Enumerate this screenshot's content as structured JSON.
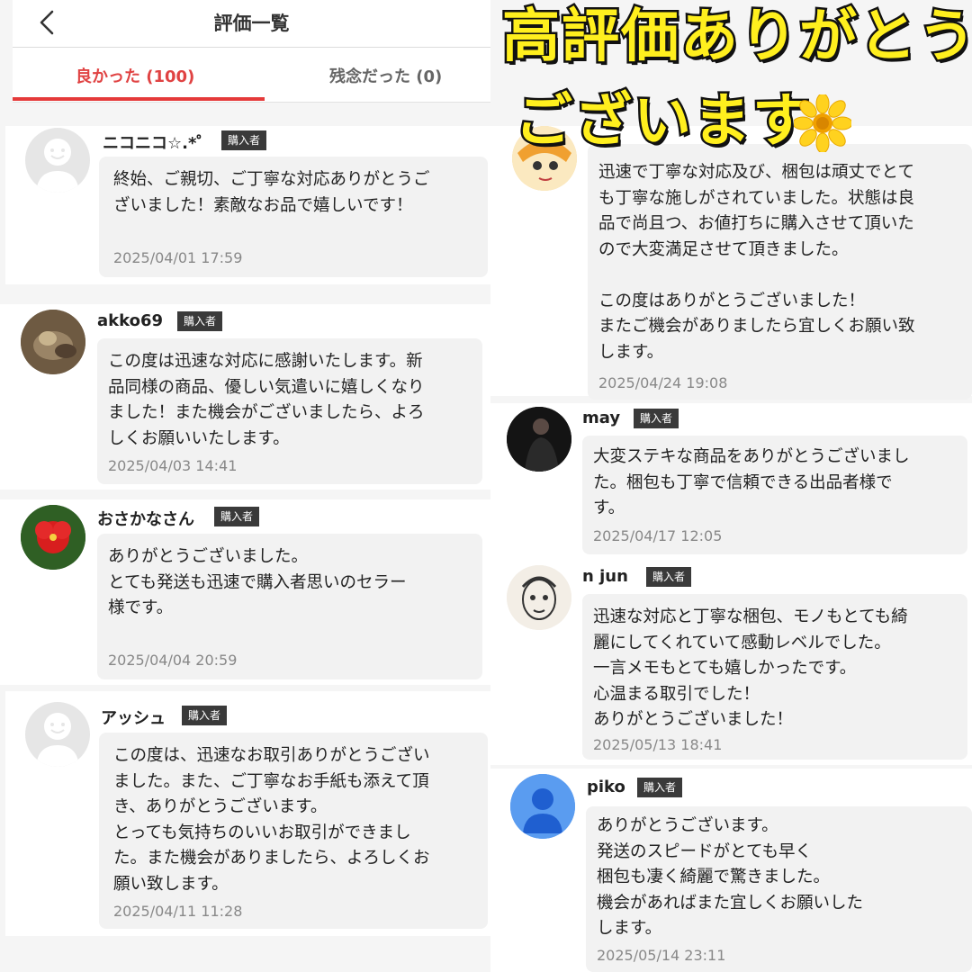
{
  "header": {
    "title": "評価一覧"
  },
  "tabs": {
    "good": "良かった (100)",
    "bad": "残念だった (0)"
  },
  "banner": {
    "line1": "高評価ありがとう",
    "line2": "ございます"
  },
  "reviews_left": [
    {
      "name": "ニコニコ☆.*゜",
      "badge": "購入者",
      "avatar": "default-avatar-icon",
      "text": "終始、ご親切、ご丁寧な対応ありがとうご\nざいました！素敵なお品で嬉しいです！",
      "date": "2025/04/01 17:59"
    },
    {
      "name": "akko69",
      "badge": "購入者",
      "avatar": "cat-photo-avatar",
      "text": "この度は迅速な対応に感謝いたします。新\n品同様の商品、優しい気遣いに嬉しくなり\nました！また機会がございましたら、よろ\nしくお願いいたします。",
      "date": "2025/04/03 14:41"
    },
    {
      "name": "おさかなさん",
      "badge": "購入者",
      "avatar": "hibiscus-photo-avatar",
      "text": "ありがとうございました。\nとても発送も迅速で購入者思いのセラー\n様です。",
      "date": "2025/04/04 20:59"
    },
    {
      "name": "アッシュ",
      "badge": "購入者",
      "avatar": "default-avatar-icon",
      "text": "この度は、迅速なお取引ありがとうござい\nました。また、ご丁寧なお手紙も添えて頂\nき、ありがとうございます。\nとっても気持ちのいいお取引ができまし\nた。また機会がありましたら、よろしくお\n願い致します。",
      "date": "2025/04/11 11:28"
    }
  ],
  "reviews_right": [
    {
      "avatar": "cartoon-avatar",
      "text": "迅速で丁寧な対応及び、梱包は頑丈でとて\nも丁寧な施しがされていました。状態は良\n品で尚且つ、お値打ちに購入させて頂いた\nので大変満足させて頂きました。\n\nこの度はありがとうございました！\nまたご機会がありましたら宜しくお願い致\nします。",
      "date": "2025/04/24 19:08"
    },
    {
      "name": "may",
      "badge": "購入者",
      "avatar": "person-photo-avatar",
      "text": "大変ステキな商品をありがとうございまし\nた。梱包も丁寧で信頼できる出品者様で\nす。",
      "date": "2025/04/17 12:05"
    },
    {
      "name": "n   jun",
      "badge": "購入者",
      "avatar": "sketch-face-avatar",
      "text": "迅速な対応と丁寧な梱包、モノもとても綺\n麗にしてくれていて感動レベルでした。\n一言メモもとても嬉しかったです。\n心温まる取引でした！\nありがとうございました！",
      "date": "2025/05/13 18:41"
    },
    {
      "name": "piko",
      "badge": "購入者",
      "avatar": "blue-user-avatar",
      "text": "ありがとうございます。\n発送のスピードがとても早く\n梱包も凄く綺麗で驚きました。\n機会があればまた宜しくお願いした\nします。",
      "date": "2025/05/14 23:11"
    }
  ]
}
